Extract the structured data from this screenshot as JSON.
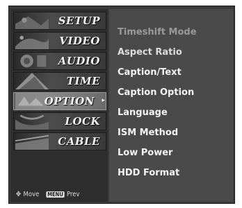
{
  "menu": {
    "items": [
      {
        "label": "SETUP",
        "active": false
      },
      {
        "label": "VIDEO",
        "active": false
      },
      {
        "label": "AUDIO",
        "active": false
      },
      {
        "label": "TIME",
        "active": false
      },
      {
        "label": "OPTION",
        "active": true
      },
      {
        "label": "LOCK",
        "active": false
      },
      {
        "label": "CABLE",
        "active": false
      }
    ],
    "hint_move": "Move",
    "hint_key": "MENU",
    "hint_prev": "Prev"
  },
  "options": {
    "items": [
      {
        "label": "Timeshift Mode",
        "state": "disabled"
      },
      {
        "label": "Aspect Ratio",
        "state": "normal"
      },
      {
        "label": "Caption/Text",
        "state": "normal"
      },
      {
        "label": "Caption Option",
        "state": "normal"
      },
      {
        "label": "Language",
        "state": "normal"
      },
      {
        "label": "ISM Method",
        "state": "normal"
      },
      {
        "label": "Low Power",
        "state": "normal"
      },
      {
        "label": "HDD Format",
        "state": "normal"
      }
    ]
  }
}
